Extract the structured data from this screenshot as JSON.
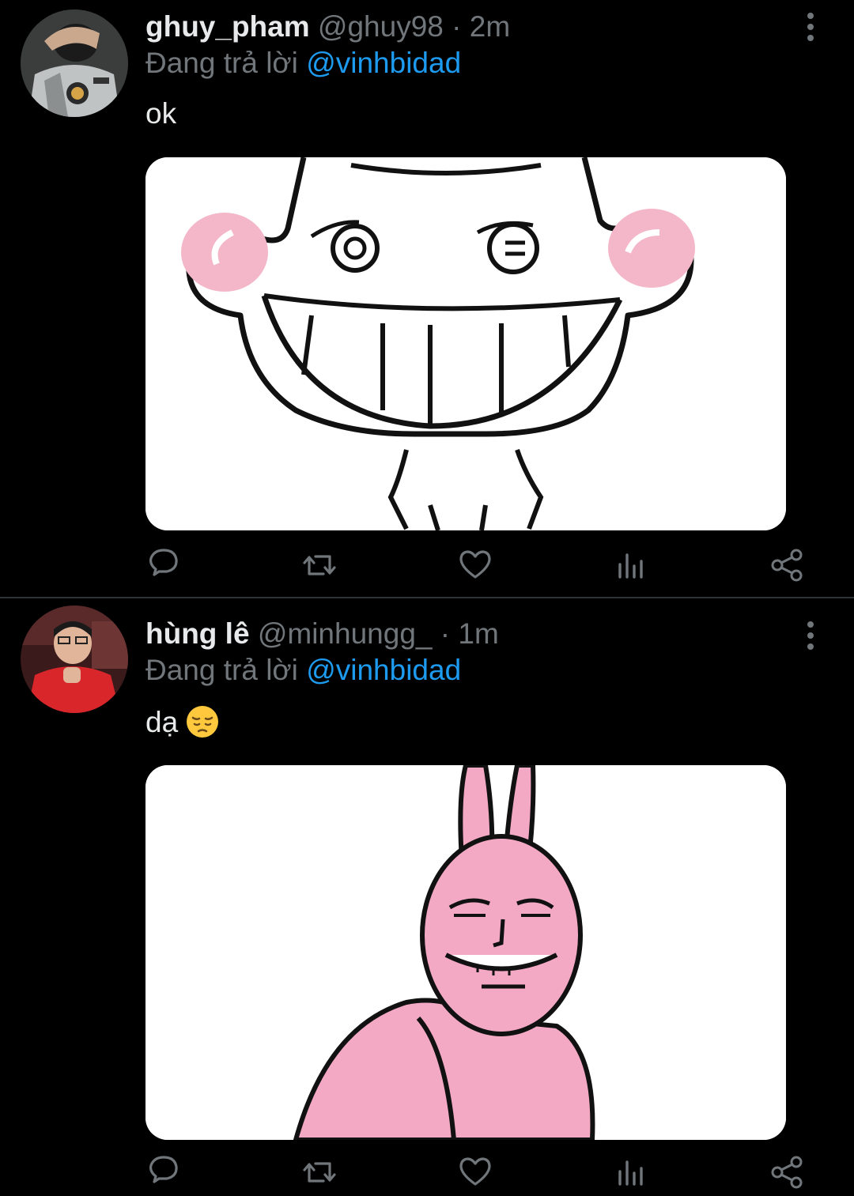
{
  "tweets": [
    {
      "name": "ghuy_pham",
      "handle": "@ghuy98",
      "separator": "·",
      "time": "2m",
      "reply_prefix": "Đang trả lời",
      "reply_to": "@vinhbidad",
      "text": "ok",
      "media_icon": "smiling-cartoon-cat-image",
      "avatar_icon": "user-avatar"
    },
    {
      "name": "hùng lê",
      "handle": "@minhungg_",
      "separator": "·",
      "time": "1m",
      "reply_prefix": "Đang trả lời",
      "reply_to": "@vinhbidad",
      "text": "dạ",
      "text_emoji": "pensive-face-emoji",
      "media_icon": "pink-rabbit-cartoon-image",
      "avatar_icon": "user-avatar"
    }
  ],
  "actions": [
    "reply-icon",
    "retweet-icon",
    "like-icon",
    "views-icon",
    "share-icon"
  ],
  "colors": {
    "background": "#000000",
    "primary_text": "#e7e9ea",
    "secondary_text": "#71767b",
    "link": "#1d9bf0",
    "divider": "#2f3336"
  }
}
